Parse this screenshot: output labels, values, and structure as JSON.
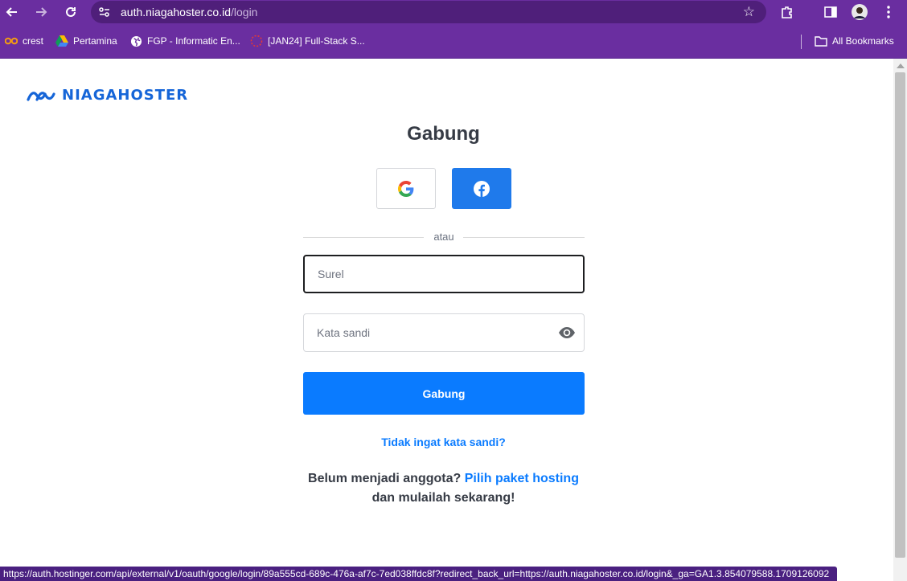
{
  "browser": {
    "url_host": "auth.niagahoster.co.id",
    "url_path": "/login",
    "bookmarks": [
      {
        "label": "crest",
        "icon": "infinity-icon"
      },
      {
        "label": "Pertamina",
        "icon": "drive-icon"
      },
      {
        "label": "FGP - Informatic En...",
        "icon": "globe-icon"
      },
      {
        "label": "[JAN24] Full-Stack S...",
        "icon": "spinner-icon"
      }
    ],
    "all_bookmarks_label": "All Bookmarks",
    "status_url": "https://auth.hostinger.com/api/external/v1/oauth/google/login/89a555cd-689c-476a-af7c-7ed038ffdc8f?redirect_back_url=https://auth.niagahoster.co.id/login&_ga=GA1.3.854079588.1709126092"
  },
  "page": {
    "logo_text": "NIAGAHOSTER",
    "title": "Gabung",
    "divider_text": "atau",
    "email_placeholder": "Surel",
    "password_placeholder": "Kata sandi",
    "submit_label": "Gabung",
    "forgot_label": "Tidak ingat kata sandi?",
    "join_prefix": "Belum menjadi anggota?",
    "join_link": "Pilih paket hosting",
    "join_suffix": "dan mulailah sekarang!"
  },
  "colors": {
    "brand_blue": "#0a7bff",
    "facebook_blue": "#1f7aeb",
    "chrome_purple": "#6a2ea0"
  }
}
